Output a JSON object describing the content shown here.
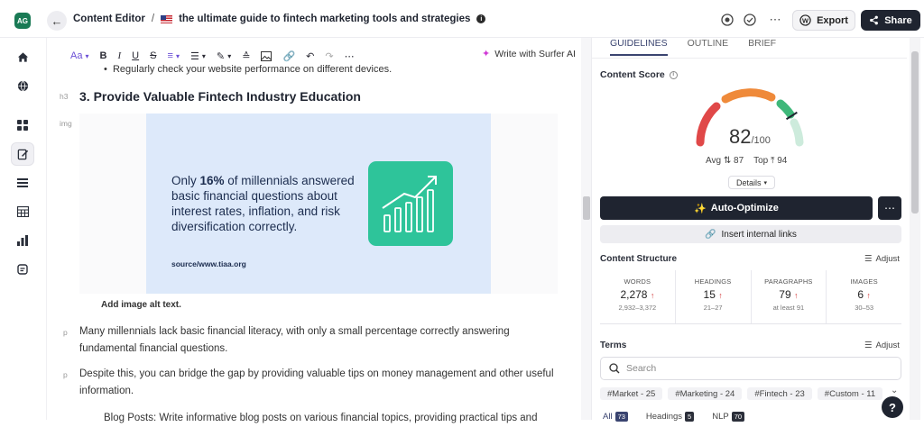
{
  "header": {
    "avatar": "AG",
    "back_icon": "arrow-left-icon",
    "breadcrumb_root": "Content Editor",
    "breadcrumb_sep": "/",
    "doc_title": "the ultimate guide to fintech marketing tools and strategies",
    "export_label": "Export",
    "share_label": "Share"
  },
  "sidebar": {
    "items": [
      {
        "name": "home",
        "icon": "home-icon"
      },
      {
        "name": "research",
        "icon": "globe-icon"
      },
      {
        "name": "apps",
        "icon": "grid-icon"
      },
      {
        "name": "content-editor",
        "icon": "edit-document-icon",
        "active": true
      },
      {
        "name": "list",
        "icon": "list-icon"
      },
      {
        "name": "table",
        "icon": "table-icon"
      },
      {
        "name": "reports",
        "icon": "bar-chart-icon"
      },
      {
        "name": "surfer",
        "icon": "surfer-icon"
      }
    ]
  },
  "editor": {
    "toolbar": {
      "font_size_label": "Aa",
      "bold": "B",
      "italic": "I",
      "underline": "U",
      "strike": "S",
      "write_ai_label": "Write with Surfer AI"
    },
    "bullet_text": "Regularly check your website performance on different devices.",
    "h3_tag": "h3",
    "h3_text": "3. Provide Valuable Fintech Industry Education",
    "img_tag": "img",
    "image": {
      "text_before": "Only ",
      "text_bold": "16%",
      "text_after": " of millennials answered basic financial questions about interest rates, inflation, and risk diversification correctly.",
      "source": "source/www.tiaa.org"
    },
    "alt_text": "Add image alt text.",
    "p_tag": "p",
    "para1": "Many millennials lack basic financial literacy, with only a small percentage correctly answering fundamental financial questions.",
    "para2": "Despite this, you can bridge the gap by providing valuable tips on money management and other useful information.",
    "para3": "Blog Posts: Write informative blog posts on various financial topics, providing practical tips and"
  },
  "panel": {
    "tabs": [
      "GUIDELINES",
      "OUTLINE",
      "BRIEF"
    ],
    "content_score_label": "Content Score",
    "score": "82",
    "score_max": "/100",
    "score_value": 82,
    "avg_label": "Avg",
    "avg_value": "87",
    "top_label": "Top",
    "top_value": "94",
    "details_label": "Details",
    "auto_optimize_label": "Auto-Optimize",
    "insert_links_label": "Insert internal links",
    "structure_label": "Content Structure",
    "adjust_label": "Adjust",
    "stats": [
      {
        "label": "WORDS",
        "value": "2,278",
        "range": "2,932–3,372"
      },
      {
        "label": "HEADINGS",
        "value": "15",
        "range": "21–27"
      },
      {
        "label": "PARAGRAPHS",
        "value": "79",
        "range": "at least 91"
      },
      {
        "label": "IMAGES",
        "value": "6",
        "range": "30–53"
      }
    ],
    "terms_label": "Terms",
    "search_placeholder": "Search",
    "chips": [
      "#Market - 25",
      "#Marketing - 24",
      "#Fintech - 23",
      "#Custom - 11"
    ],
    "filter_tabs": [
      {
        "label": "All",
        "count": "73"
      },
      {
        "label": "Headings",
        "count": "5"
      },
      {
        "label": "NLP",
        "count": "70"
      }
    ]
  },
  "colors": {
    "primary_dark": "#1f2430",
    "gauge_red": "#e04848",
    "gauge_orange": "#ef8a3a",
    "gauge_green": "#3fb87a",
    "gauge_light_green": "#cdebdc",
    "accent_purple": "#8a6adf"
  }
}
